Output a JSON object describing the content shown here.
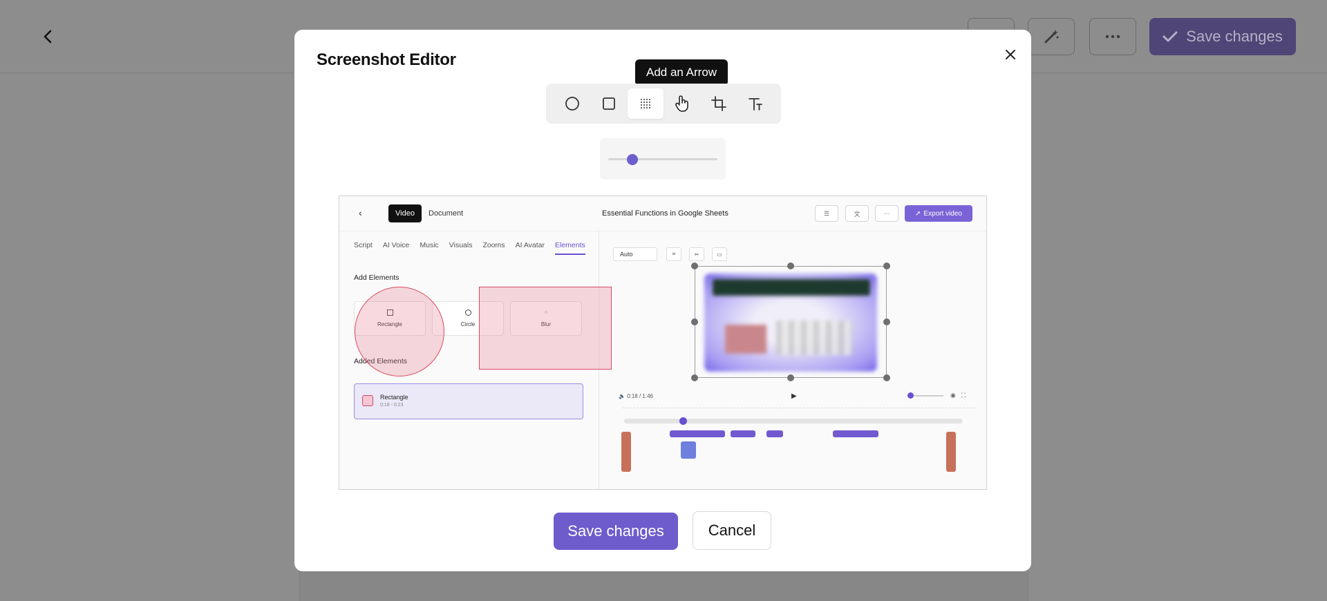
{
  "background": {
    "save_label": "Save changes",
    "back_icon": "chevron-left-icon",
    "toolbar_icons": [
      "blank-button",
      "magic-wand-icon",
      "more-horizontal-icon"
    ]
  },
  "modal": {
    "title": "Screenshot Editor",
    "close_icon": "close-icon",
    "tooltip": "Add an Arrow",
    "tools": [
      {
        "name": "circle-tool",
        "icon": "circle-icon"
      },
      {
        "name": "rectangle-tool",
        "icon": "square-icon"
      },
      {
        "name": "blur-tool",
        "icon": "blur-grid-icon",
        "active": true
      },
      {
        "name": "arrow-tool",
        "icon": "hand-pointer-icon"
      },
      {
        "name": "crop-tool",
        "icon": "crop-icon"
      },
      {
        "name": "text-tool",
        "icon": "text-icon"
      }
    ],
    "slider_value": 0.2,
    "save_label": "Save changes",
    "cancel_label": "Cancel"
  },
  "preview": {
    "toggle_video": "Video",
    "toggle_document": "Document",
    "doc_title": "Essential Functions in Google Sheets",
    "export_label": "Export video",
    "tabs": [
      "Script",
      "AI Voice",
      "Music",
      "Visuals",
      "Zooms",
      "AI Avatar",
      "Elements"
    ],
    "active_tab": "Elements",
    "add_elements_label": "Add Elements",
    "cards": [
      "Rectangle",
      "Circle",
      "Blur"
    ],
    "added_elements_label": "Added Elements",
    "added_item": {
      "name": "Rectangle",
      "time": "0:18 - 0:23"
    },
    "auto_label": "Auto",
    "time_readout": "0:18 / 1:46",
    "colors": {
      "accent": "#6e5ccd",
      "annotation": "#d94a5e"
    }
  }
}
